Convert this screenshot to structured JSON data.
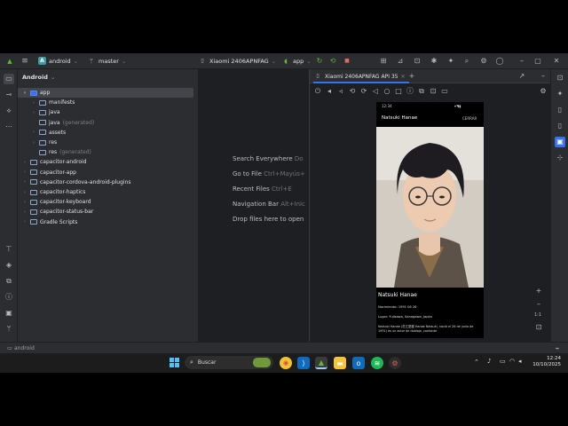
{
  "titlebar": {
    "project_initial": "A",
    "project": "android",
    "branch": "master",
    "device": "Xiaomi 2406APNFAG",
    "run_config": "app"
  },
  "project_panel": {
    "title": "Android",
    "tree": [
      {
        "label": "app",
        "suffix": ""
      },
      {
        "label": "manifests",
        "suffix": ""
      },
      {
        "label": "java",
        "suffix": ""
      },
      {
        "label": "java",
        "suffix": "(generated)"
      },
      {
        "label": "assets",
        "suffix": ""
      },
      {
        "label": "res",
        "suffix": ""
      },
      {
        "label": "res",
        "suffix": "(generated)"
      },
      {
        "label": "capacitor-android",
        "suffix": ""
      },
      {
        "label": "capacitor-app",
        "suffix": ""
      },
      {
        "label": "capacitor-cordova-android-plugins",
        "suffix": ""
      },
      {
        "label": "capacitor-haptics",
        "suffix": ""
      },
      {
        "label": "capacitor-keyboard",
        "suffix": ""
      },
      {
        "label": "capacitor-status-bar",
        "suffix": ""
      },
      {
        "label": "Gradle Scripts",
        "suffix": ""
      }
    ]
  },
  "editor_hints": [
    {
      "label": "Search Everywhere",
      "shortcut": "Do"
    },
    {
      "label": "Go to File",
      "shortcut": "Ctrl+Mayús+"
    },
    {
      "label": "Recent Files",
      "shortcut": "Ctrl+E"
    },
    {
      "label": "Navigation Bar",
      "shortcut": "Alt+Inic"
    },
    {
      "label": "Drop files here to open",
      "shortcut": ""
    }
  ],
  "running_devices": {
    "tab_label": "Xiaomi 2406APNFAG API 35",
    "zoom_label": "1:1"
  },
  "phone": {
    "time": "12:34",
    "app_title": "Natsuki Hanae",
    "action": "CERRAR",
    "name": "Natsuki Hanae",
    "birth": "Nacimiento: 1991 06 26",
    "place": "Lugar: Fujisawa, Kanagawa, Japón",
    "bio": "Natsuki Hanae (花江夏樹 Hanae Natsuki, nació el 26 de junio de 1991) es un actor de doblaje, cantante"
  },
  "statusbar": {
    "path": "android"
  },
  "taskbar": {
    "search_placeholder": "Buscar",
    "time": "12:24",
    "date": "10/10/2025"
  },
  "colors": {
    "accent": "#3574f0",
    "editor_bg": "#1e1f22",
    "panel_bg": "#2b2d30",
    "selected_row": "#43454a"
  }
}
